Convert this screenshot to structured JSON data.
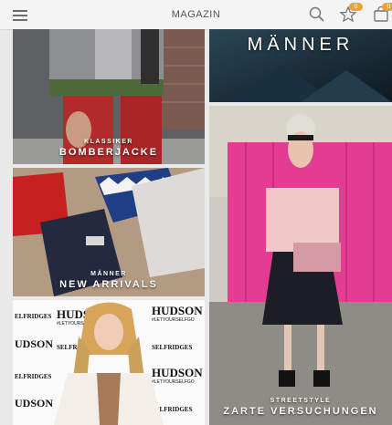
{
  "header": {
    "title": "MAGAZIN",
    "badge_watchlist": "0",
    "badge_cart": "0"
  },
  "tiles": [
    {
      "kicker": "KLASSIKER",
      "headline": "BOMBERJACKE"
    },
    {
      "kicker": "",
      "headline": "MÄNNER"
    },
    {
      "kicker": "MÄNNER",
      "headline": "NEW ARRIVALS"
    },
    {
      "kicker": "STREETSTYLE",
      "headline": "ZARTE VERSUCHUNGEN"
    }
  ],
  "hudson_wall": {
    "brand": "HUDSON",
    "brand_partial": "UDSON",
    "selfridges": "SELFRIDGES",
    "selfridges_partial": "ELFRIDGES",
    "tagline": "#LETYOURSELFGO"
  },
  "colors": {
    "accent_badge": "#f0a030",
    "magenta_container": "#e23c93"
  }
}
